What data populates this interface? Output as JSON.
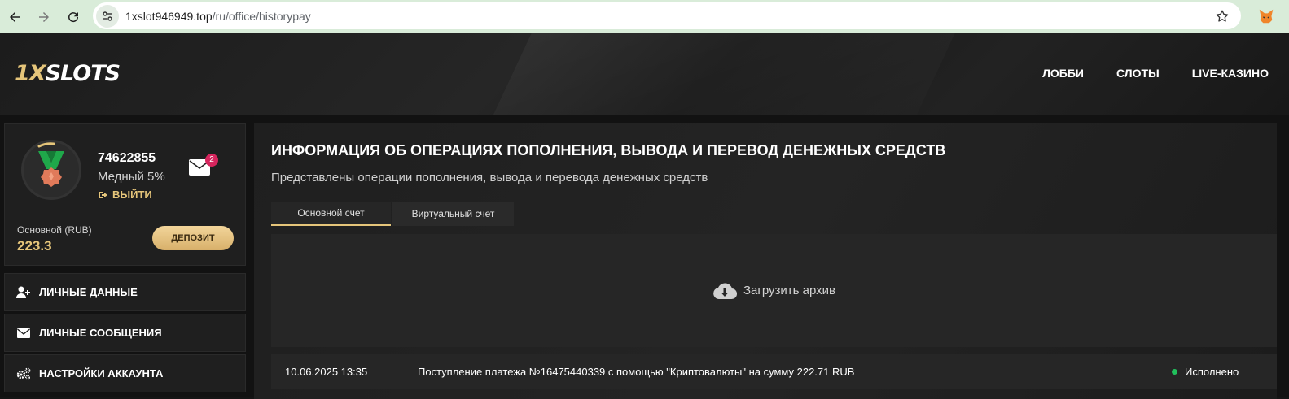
{
  "browser": {
    "url_host": "1xslot946949.top",
    "url_path": "/ru/office/historypay"
  },
  "header": {
    "logo_prefix": "1X",
    "logo_rest": "SLOTS",
    "nav": [
      "ЛОББИ",
      "СЛОТЫ",
      "LIVE-КАЗИНО"
    ]
  },
  "profile": {
    "user_id": "74622855",
    "level": "Медный 5%",
    "logout_label": "ВЫЙТИ",
    "messages_badge": "2",
    "balance_label": "Основной (RUB)",
    "balance_value": "223.3",
    "deposit_label": "ДЕПОЗИТ"
  },
  "sidebar": {
    "items": [
      {
        "label": "ЛИЧНЫЕ ДАННЫЕ",
        "icon": "user-plus-icon"
      },
      {
        "label": "ЛИЧНЫЕ СООБЩЕНИЯ",
        "icon": "envelope-icon"
      },
      {
        "label": "НАСТРОЙКИ АККАУНТА",
        "icon": "gears-icon"
      }
    ]
  },
  "main": {
    "title": "ИНФОРМАЦИЯ ОБ ОПЕРАЦИЯХ ПОПОЛНЕНИЯ, ВЫВОДА И ПЕРЕВОД ДЕНЕЖНЫХ СРЕДСТВ",
    "subtitle": "Представлены операции пополнения, вывода и перевода денежных средств",
    "tabs": [
      {
        "label": "Основной счет",
        "active": true
      },
      {
        "label": "Виртуальный счет",
        "active": false
      }
    ],
    "archive_label": "Загрузить архив",
    "operations": [
      {
        "date": "10.06.2025 13:35",
        "description": "Поступление платежа №16475440339 с помощью \"Криптовалюты\" на сумму 222.71 RUB",
        "status": "Исполнено"
      }
    ]
  },
  "colors": {
    "accent_gold": "#e5c57a",
    "status_green": "#21c05c",
    "badge_pink": "#d6255d"
  }
}
